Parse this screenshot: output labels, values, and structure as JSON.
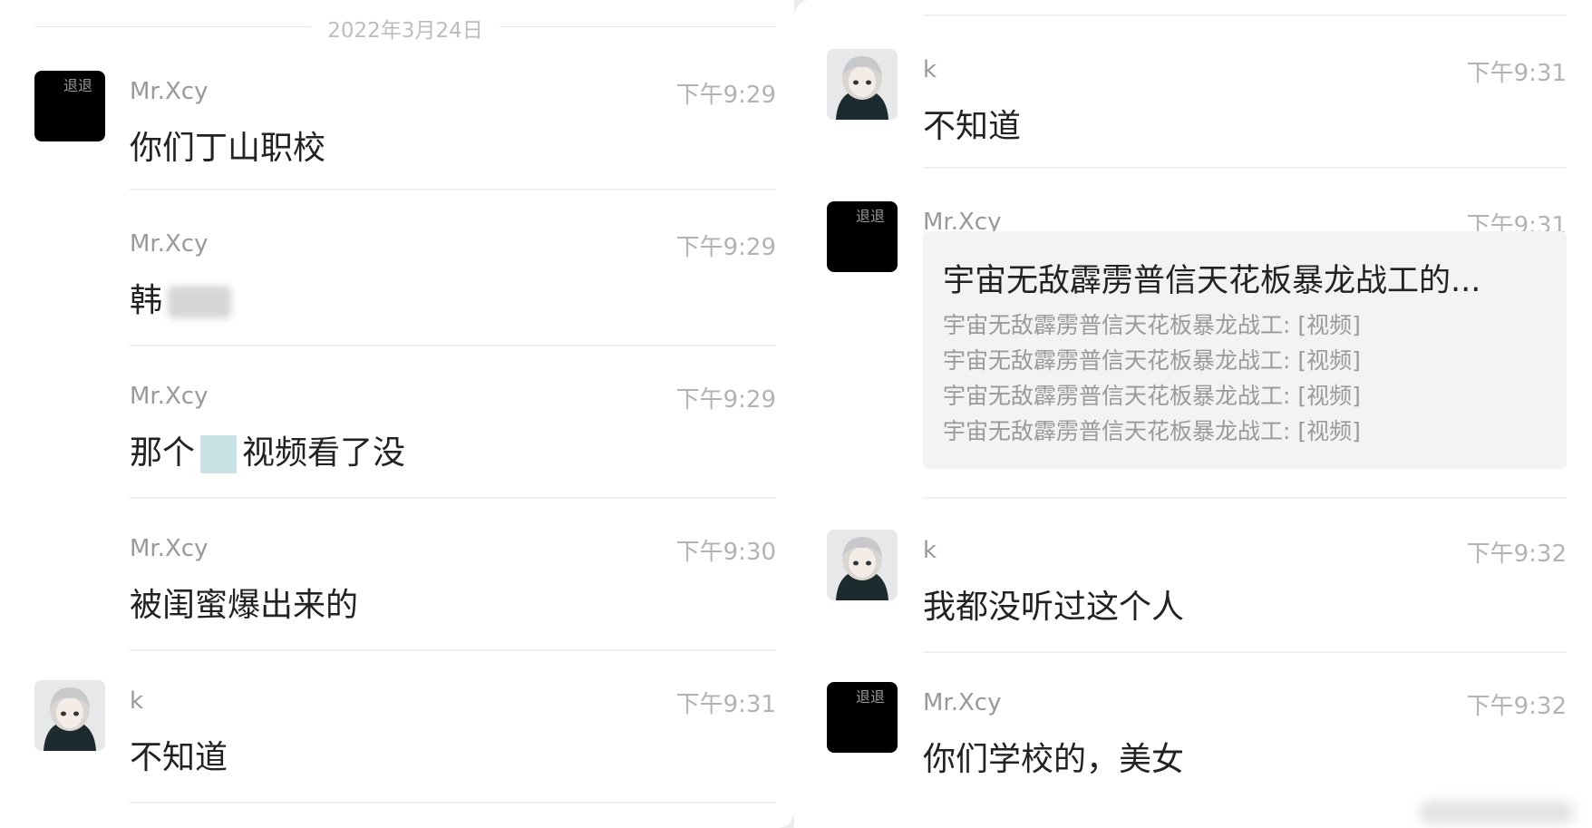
{
  "date_divider": "2022年3月24日",
  "left_messages": [
    {
      "sender": "Mr.Xcy",
      "time": "下午9:29",
      "text": "你们丁山职校",
      "avatar": "black-logo-avatar"
    },
    {
      "sender": "Mr.Xcy",
      "time": "下午9:29",
      "text": "韩",
      "avatar": ""
    },
    {
      "sender": "Mr.Xcy",
      "time": "下午9:29",
      "text_before": "那个",
      "text_after": "视频看了没",
      "avatar": ""
    },
    {
      "sender": "Mr.Xcy",
      "time": "下午9:30",
      "text": "被闺蜜爆出来的",
      "avatar": ""
    },
    {
      "sender": "k",
      "time": "下午9:31",
      "text": "不知道",
      "avatar": "anime-girl-avatar"
    }
  ],
  "right_messages": [
    {
      "sender": "k",
      "time": "下午9:31",
      "text": "不知道",
      "avatar": "anime-girl-avatar"
    },
    {
      "sender": "Mr.Xcy",
      "time": "下午9:31",
      "text": "",
      "avatar": "black-logo-avatar"
    },
    {
      "sender": "k",
      "time": "下午9:32",
      "text": "我都没听过这个人",
      "avatar": "anime-girl-avatar"
    },
    {
      "sender": "Mr.Xcy",
      "time": "下午9:32",
      "text": "你们学校的，美女",
      "avatar": "black-logo-avatar"
    }
  ],
  "forwarded_card": {
    "title": "宇宙无敌霹雳普信天花板暴龙战工的...",
    "lines": [
      "宇宙无敌霹雳普信天花板暴龙战工: [视频]",
      "宇宙无敌霹雳普信天花板暴龙战工: [视频]",
      "宇宙无敌霹雳普信天花板暴龙战工: [视频]",
      "宇宙无敌霹雳普信天花板暴龙战工: [视频]"
    ]
  },
  "avatar_logo_text": "退退",
  "colors": {
    "panel_bg": "#ffffff",
    "outer_bg": "#ececec",
    "name_gray": "#999999",
    "text_dark": "#222222",
    "card_bg": "#f3f3f3"
  }
}
